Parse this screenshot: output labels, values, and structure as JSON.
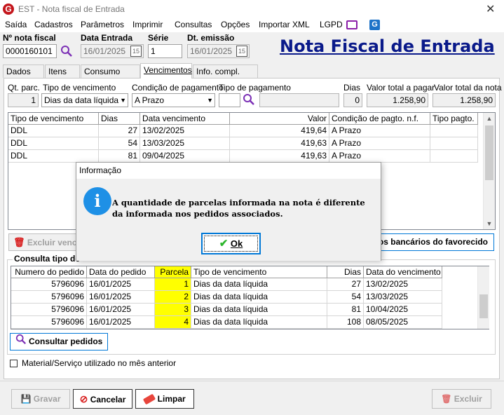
{
  "window": {
    "title": "EST - Nota fiscal de Entrada",
    "logo_letter": "G",
    "close_glyph": "✕"
  },
  "menu": {
    "items": [
      "Saída",
      "Cadastros",
      "Parâmetros",
      "Imprimir",
      "Consultas",
      "Opções",
      "Importar XML",
      "LGPD"
    ]
  },
  "header": {
    "nota_label": "Nº nota fiscal",
    "nota_value": "0000160101",
    "data_entrada_label": "Data Entrada",
    "data_entrada_value": "16/01/2025",
    "serie_label": "Série",
    "serie_value": "1",
    "dt_emissao_label": "Dt. emissão",
    "dt_emissao_value": "16/01/2025",
    "big_title": "Nota Fiscal de Entrada",
    "cal_glyph": "15"
  },
  "tabs": [
    "Dados NF",
    "Itens NF",
    "Consumo direto",
    "Vencimentos",
    "Info. compl. Sped"
  ],
  "active_tab": "Vencimentos",
  "filters": {
    "qt_parc_label": "Qt. parc.",
    "qt_parc_value": "1",
    "tipo_venc_label": "Tipo de vencimento",
    "tipo_venc_value": "Dias da data líquida",
    "cond_pag_label": "Condição de pagamento",
    "cond_pag_value": "A Prazo",
    "tipo_pag_label": "Tipo de pagamento",
    "tipo_pag_value": "",
    "dias_label": "Dias",
    "dias_value": "0",
    "valor_pagar_label": "Valor total a pagar",
    "valor_pagar_value": "1.258,90",
    "valor_nota_label": "Valor total da nota",
    "valor_nota_value": "1.258,90"
  },
  "venc_table": {
    "headers": [
      "Tipo de vencimento",
      "Dias",
      "Data vencimento",
      "Valor",
      "Condição de pagto. n.f.",
      "Tipo pagto."
    ],
    "rows": [
      [
        "DDL",
        "27",
        "13/02/2025",
        "419,64",
        "A Prazo",
        ""
      ],
      [
        "DDL",
        "54",
        "13/03/2025",
        "419,63",
        "A Prazo",
        ""
      ],
      [
        "DDL",
        "81",
        "09/04/2025",
        "419,63",
        "A Prazo",
        ""
      ]
    ]
  },
  "buttons": {
    "excluir_venc": "Excluir venc",
    "dados_bancarios": "os bancários do favorecido",
    "consultar_pedidos": "Consultar pedidos",
    "gravar": "Gravar",
    "cancelar": "Cancelar",
    "limpar": "Limpar",
    "excluir": "Excluir"
  },
  "consulta": {
    "legend": "Consulta tipo de",
    "headers": [
      "Numero do pedido",
      "Data do pedido",
      "Parcela",
      "Tipo de vencimento",
      "Dias",
      "Data do vencimento"
    ],
    "rows": [
      [
        "5796096",
        "16/01/2025",
        "1",
        "Dias da data líquida",
        "27",
        "13/02/2025"
      ],
      [
        "5796096",
        "16/01/2025",
        "2",
        "Dias da data líquida",
        "54",
        "13/03/2025"
      ],
      [
        "5796096",
        "16/01/2025",
        "3",
        "Dias da data líquida",
        "81",
        "10/04/2025"
      ],
      [
        "5796096",
        "16/01/2025",
        "4",
        "Dias da data líquida",
        "108",
        "08/05/2025"
      ]
    ]
  },
  "checkbox": {
    "label": "Material/Serviço utilizado no mês anterior",
    "checked": false
  },
  "dialog": {
    "title": "Informação",
    "icon_glyph": "i",
    "message": "A quantidade de parcelas informada na nota é diferente da informada nos pedidos associados.",
    "ok_label": "Ok"
  },
  "colors": {
    "title_blue": "#0a1a8a",
    "highlight_yellow": "#ffff00",
    "accent_blue": "#0078d7",
    "info_blue": "#1e90e6",
    "brand_red": "#c4161c"
  }
}
